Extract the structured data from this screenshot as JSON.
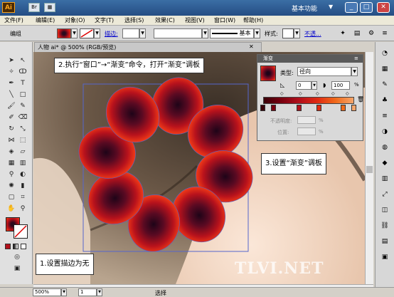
{
  "titlebar": {
    "app_logo": "Ai",
    "workspace": "基本功能",
    "workspace_arrow": "▼",
    "icons": [
      "bridge-icon",
      "arrange-icon"
    ],
    "minimize": "_",
    "restore": "□",
    "close": "✕"
  },
  "menu": [
    "文件(F)",
    "编辑(E)",
    "对象(O)",
    "文字(T)",
    "选择(S)",
    "效果(C)",
    "视图(V)",
    "窗口(W)",
    "帮助(H)"
  ],
  "options": {
    "label": "编组",
    "stroke_label": "描边:",
    "style_label": "样式:",
    "basic": "基本",
    "opacity_link": "不透..."
  },
  "document": {
    "tab": "人物 ai* @ 500% (RGB/预览)",
    "close": "✕",
    "zoom": "500%",
    "page": "1",
    "status": "选择"
  },
  "gradient_panel": {
    "title": "渐变",
    "type_label": "类型:",
    "type_value": "径向",
    "angle": "0",
    "aspect": "100",
    "percent": "%",
    "opacity_label": "不透明度:",
    "location_label": "位置:",
    "stop_colors": [
      "#3a0008",
      "#7a0010",
      "#b3101b",
      "#e02a12",
      "#f06a1a",
      "#f5a56a"
    ]
  },
  "callouts": {
    "step1": "1.设置描边为无",
    "step2": "2.执行“窗口”→“渐变”命令，打开“渐变”调板",
    "step3": "3.设置“渐变”调板"
  },
  "watermark": "TLVI.NET",
  "colors": {
    "petal_center": "#2a0a1e",
    "petal_mid": "#8a0e26",
    "petal_edge": "#ff3a12",
    "selection": "#5566cc"
  }
}
